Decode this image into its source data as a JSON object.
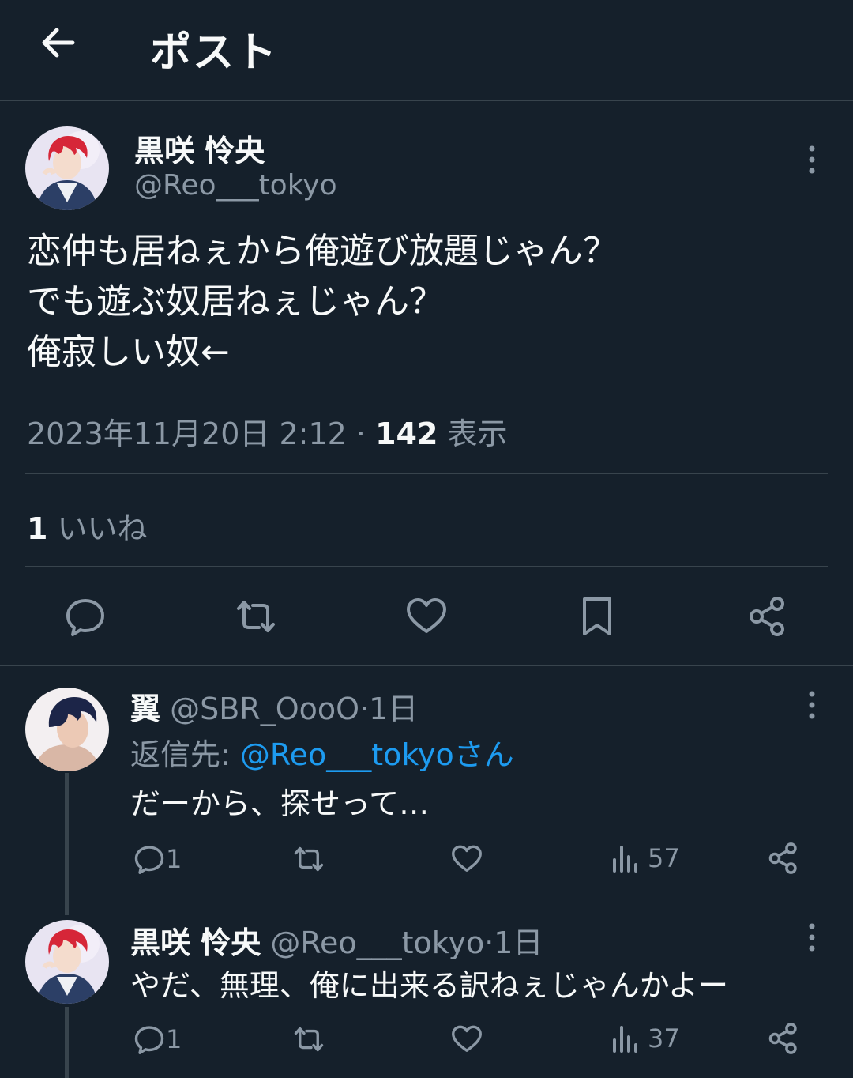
{
  "header": {
    "title": "ポスト",
    "back_icon": "arrow-left-icon"
  },
  "post": {
    "author_name": "黒咲 怜央",
    "author_handle": "@Reo___tokyo",
    "text": "恋仲も居ねぇから俺遊び放題じゃん？\nでも遊ぶ奴居ねぇじゃん？\n俺寂しい奴←",
    "timestamp": "2023年11月20日 2:12",
    "separator": "·",
    "views_count": "142",
    "views_label": "表示",
    "likes_count": "1",
    "likes_label": "いいね",
    "actions": [
      "reply-icon",
      "repost-icon",
      "like-icon",
      "bookmark-icon",
      "share-icon"
    ]
  },
  "replies": [
    {
      "author_name": "翼",
      "author_handle": "@SBR_OooO",
      "time": "1日",
      "separator": "·",
      "reply_to_label": "返信先:",
      "reply_to_handle": "@Reo___tokyoさん",
      "text": "だーから、探せって…",
      "reply_count": "1",
      "views": "57"
    },
    {
      "author_name": "黒咲 怜央",
      "author_handle": "@Reo___tokyo",
      "time": "1日",
      "separator": "·",
      "text": "やだ、無理、俺に出来る訳ねぇじゃんかよー",
      "reply_count": "1",
      "views": "37"
    }
  ],
  "colors": {
    "background": "#15202b",
    "text": "#f7f9f9",
    "muted": "#8b98a5",
    "link": "#1d9bf0",
    "border": "#38444d"
  }
}
